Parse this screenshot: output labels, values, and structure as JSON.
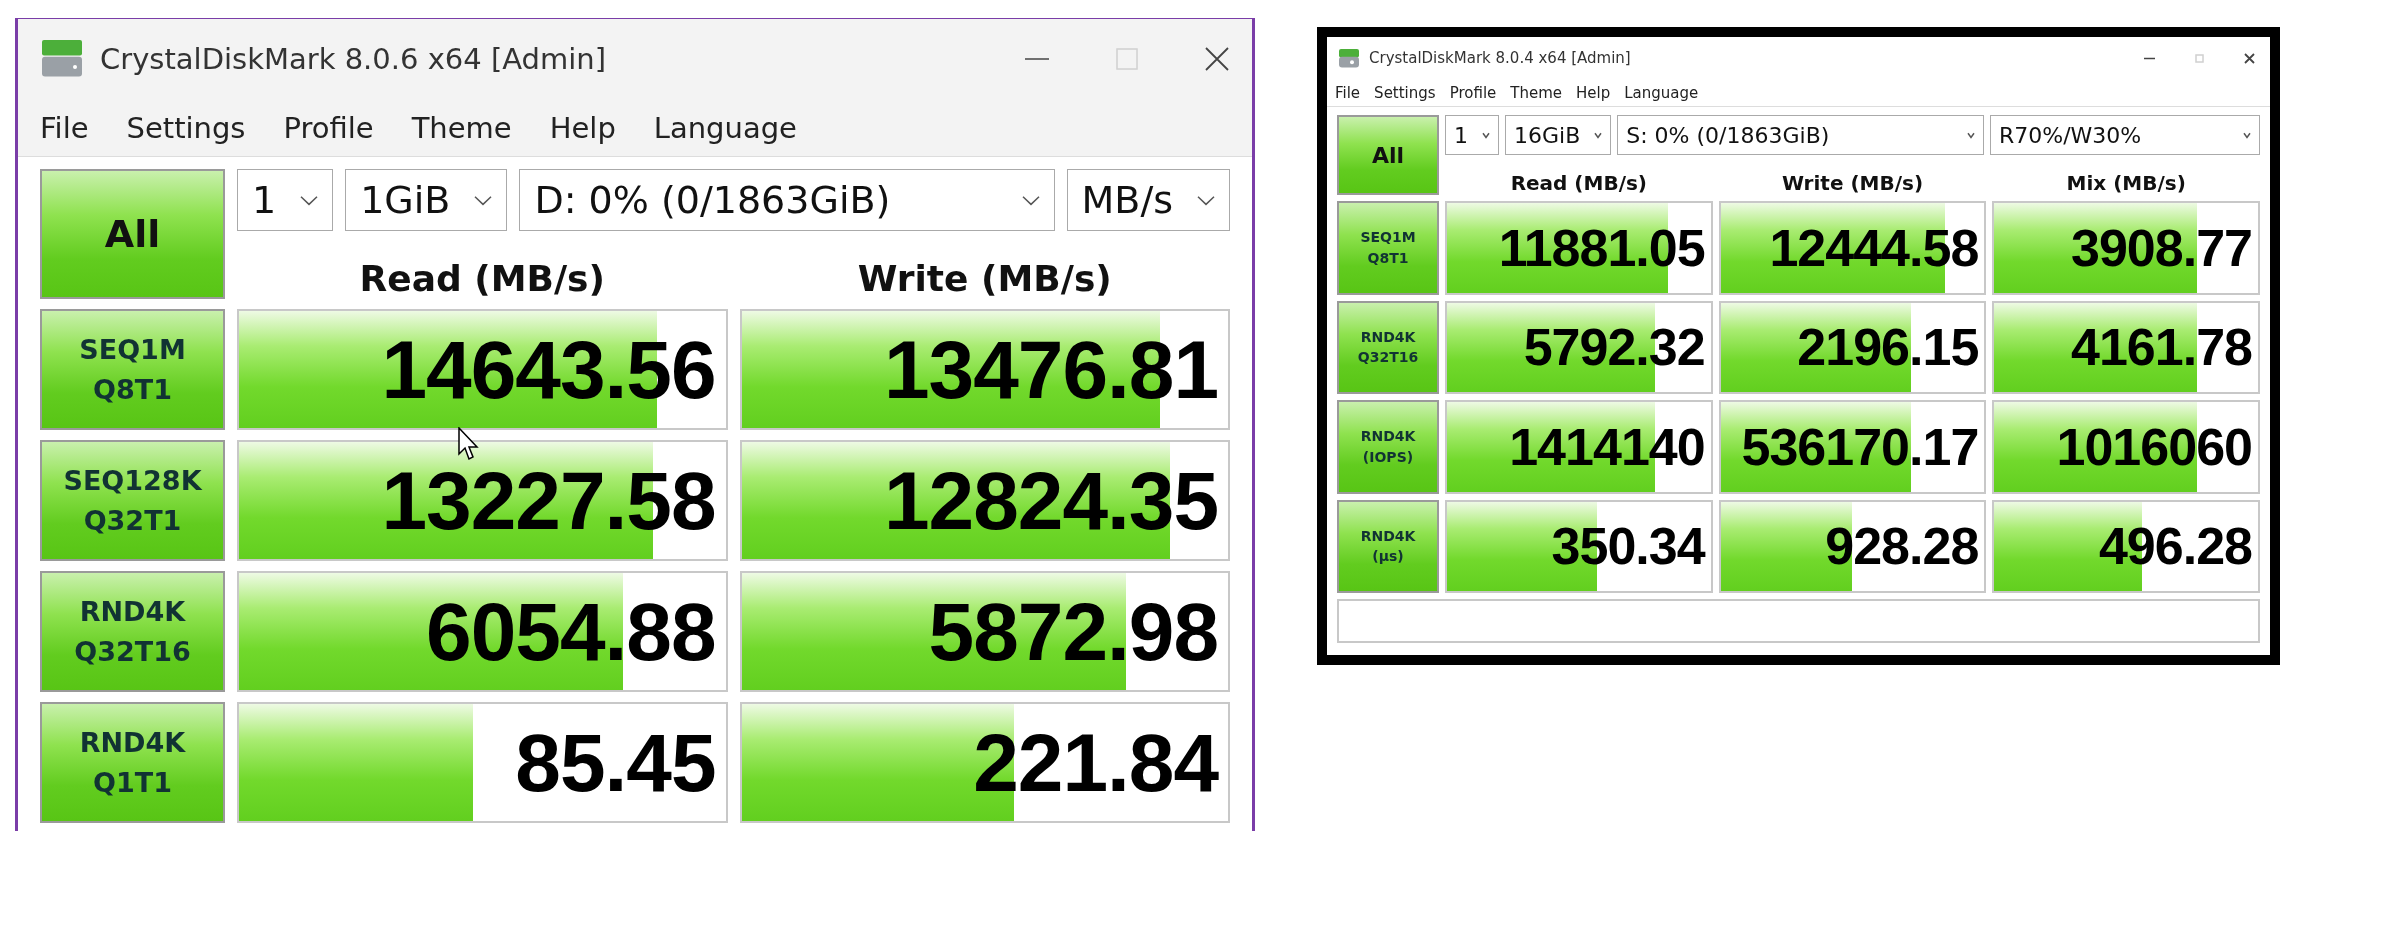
{
  "windows": [
    {
      "title": "CrystalDiskMark 8.0.6 x64 [Admin]",
      "menu": [
        "File",
        "Settings",
        "Profile",
        "Theme",
        "Help",
        "Language"
      ],
      "all_button": "All",
      "selectors": [
        "1",
        "1GiB",
        "D: 0% (0/1863GiB)",
        "MB/s"
      ],
      "columns": [
        "Read (MB/s)",
        "Write (MB/s)"
      ],
      "tests": [
        {
          "label": [
            "SEQ1M",
            "Q8T1"
          ],
          "results": [
            {
              "value": "14643.56",
              "level": 0.86
            },
            {
              "value": "13476.81",
              "level": 0.86
            }
          ]
        },
        {
          "label": [
            "SEQ128K",
            "Q32T1"
          ],
          "results": [
            {
              "value": "13227.58",
              "level": 0.85
            },
            {
              "value": "12824.35",
              "level": 0.88
            }
          ]
        },
        {
          "label": [
            "RND4K",
            "Q32T16"
          ],
          "results": [
            {
              "value": "6054.88",
              "level": 0.79
            },
            {
              "value": "5872.98",
              "level": 0.79
            }
          ]
        },
        {
          "label": [
            "RND4K",
            "Q1T1"
          ],
          "results": [
            {
              "value": "85.45",
              "level": 0.48
            },
            {
              "value": "221.84",
              "level": 0.56
            }
          ]
        }
      ]
    },
    {
      "title": "CrystalDiskMark 8.0.4 x64 [Admin]",
      "menu": [
        "File",
        "Settings",
        "Profile",
        "Theme",
        "Help",
        "Language"
      ],
      "all_button": "All",
      "selectors": [
        "1",
        "16GiB",
        "S: 0% (0/1863GiB)",
        "R70%/W30%"
      ],
      "columns": [
        "Read (MB/s)",
        "Write (MB/s)",
        "Mix (MB/s)"
      ],
      "tests": [
        {
          "label": [
            "SEQ1M",
            "Q8T1"
          ],
          "results": [
            {
              "value": "11881.05",
              "level": 0.84
            },
            {
              "value": "12444.58",
              "level": 0.85
            },
            {
              "value": "3908.77",
              "level": 0.77
            }
          ]
        },
        {
          "label": [
            "RND4K",
            "Q32T16"
          ],
          "results": [
            {
              "value": "5792.32",
              "level": 0.79
            },
            {
              "value": "2196.15",
              "level": 0.72
            },
            {
              "value": "4161.78",
              "level": 0.77
            }
          ]
        },
        {
          "label": [
            "RND4K",
            "(IOPS)"
          ],
          "results": [
            {
              "value": "1414140",
              "level": 0.79
            },
            {
              "value": "536170.17",
              "level": 0.72
            },
            {
              "value": "1016060",
              "level": 0.77
            }
          ]
        },
        {
          "label": [
            "RND4K",
            "(μs)"
          ],
          "results": [
            {
              "value": "350.34",
              "level": 0.57
            },
            {
              "value": "928.28",
              "level": 0.5
            },
            {
              "value": "496.28",
              "level": 0.56
            }
          ]
        }
      ],
      "comment_field": true
    }
  ]
}
